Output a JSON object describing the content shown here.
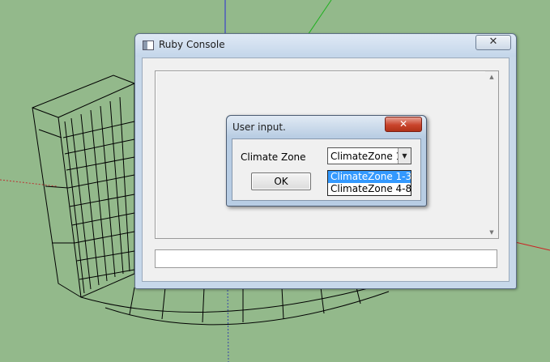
{
  "console": {
    "title": "Ruby Console",
    "close_glyph": "✕",
    "scroll_up_glyph": "▲",
    "scroll_down_glyph": "▼",
    "icon": "window-icon"
  },
  "dialog": {
    "title": "User input.",
    "close_glyph": "✕",
    "field_label": "Climate Zone",
    "selected_value": "ClimateZone 1-3",
    "dropdown_arrow_glyph": "▼",
    "ok_label": "OK",
    "options": [
      "ClimateZone 1-3",
      "ClimateZone 4-8"
    ]
  },
  "colors": {
    "viewport_background": "#93b98b",
    "selection_highlight": "#3399ff",
    "dialog_close_red": "#c9442c"
  }
}
